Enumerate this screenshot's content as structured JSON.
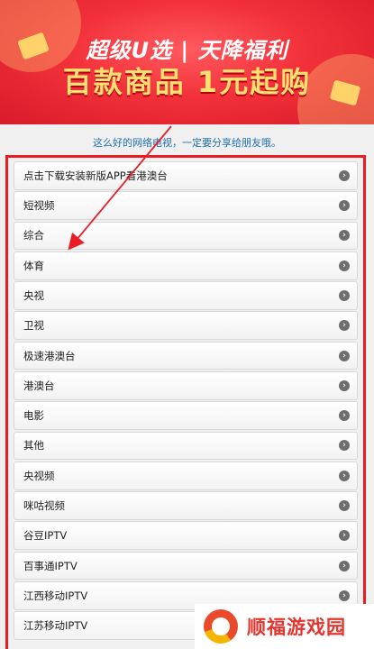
{
  "banner": {
    "line1": "超级U选 | 天降福利",
    "line2": "百款商品 1元起购"
  },
  "intro": "这么好的网络电视，一定要分享给朋友哦。",
  "items": [
    {
      "label": "点击下载安装新版APP看港澳台"
    },
    {
      "label": "短视频"
    },
    {
      "label": "综合"
    },
    {
      "label": "体育"
    },
    {
      "label": "央视"
    },
    {
      "label": "卫视"
    },
    {
      "label": "极速港澳台"
    },
    {
      "label": "港澳台"
    },
    {
      "label": "电影"
    },
    {
      "label": "其他"
    },
    {
      "label": "央视频"
    },
    {
      "label": "咪咕视频"
    },
    {
      "label": "谷豆IPTV"
    },
    {
      "label": "百事通IPTV"
    },
    {
      "label": "江西移动IPTV"
    },
    {
      "label": "江苏移动IPTV"
    }
  ],
  "watermark": {
    "text": "顺福游戏园"
  },
  "colors": {
    "accent": "#e81e24",
    "intro_text": "#1f6fb3"
  }
}
